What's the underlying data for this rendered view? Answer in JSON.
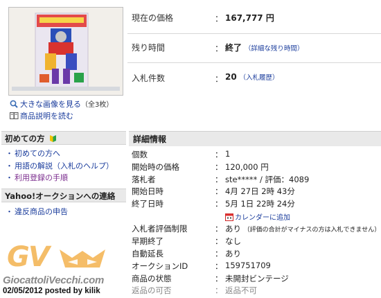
{
  "left": {
    "enlarge_link": "大きな画像を見る",
    "enlarge_count": "（全3枚）",
    "description_link": "商品説明を読む"
  },
  "beginner": {
    "heading": "初めての方",
    "items": [
      "初めての方へ",
      "用語の解説（入札のヘルプ）",
      "利用登録の手順"
    ]
  },
  "contact": {
    "heading": "Yahoo!オークションへの連絡",
    "items": [
      "違反商品の申告"
    ]
  },
  "summary": {
    "price_label": "現在の価格",
    "price_value": "167,777 円",
    "time_label": "残り時間",
    "time_value": "終了",
    "time_link": "（詳細な残り時間）",
    "bids_label": "入札件数",
    "bids_value": "20",
    "bids_link": "（入札履歴）",
    "colon": "："
  },
  "detail": {
    "heading": "詳細情報",
    "rows": [
      {
        "label": "個数",
        "value": "1"
      },
      {
        "label": "開始時の価格",
        "value": "120,000 円"
      },
      {
        "label": "落札者",
        "value": "ste***** / 評価：4089"
      },
      {
        "label": "開始日時",
        "value": "4月 27日 2時 43分"
      },
      {
        "label": "終了日時",
        "value": "5月 1日 22時 24分"
      },
      {
        "label": "",
        "value": "カレンダーに追加"
      },
      {
        "label": "入札者評価制限",
        "value": "あり",
        "note": "（評価の合計がマイナスの方は入札できません）"
      },
      {
        "label": "早期終了",
        "value": "なし"
      },
      {
        "label": "自動延長",
        "value": "あり"
      },
      {
        "label": "オークションID",
        "value": "159751709"
      },
      {
        "label": "商品の状態",
        "value": "未開封ビンテージ"
      },
      {
        "label": "返品の可否",
        "value": "返品不可"
      }
    ]
  },
  "watermark": {
    "logo": "GV",
    "site": "GiocattoliVecchi.com",
    "date_line": "02/05/2012 posted by kilik"
  },
  "colors": {
    "link": "#1a3c9c",
    "visited": "#7b2d8e",
    "section_bg": "#e9e9e9",
    "watermark_orange": "#f3b24e"
  }
}
